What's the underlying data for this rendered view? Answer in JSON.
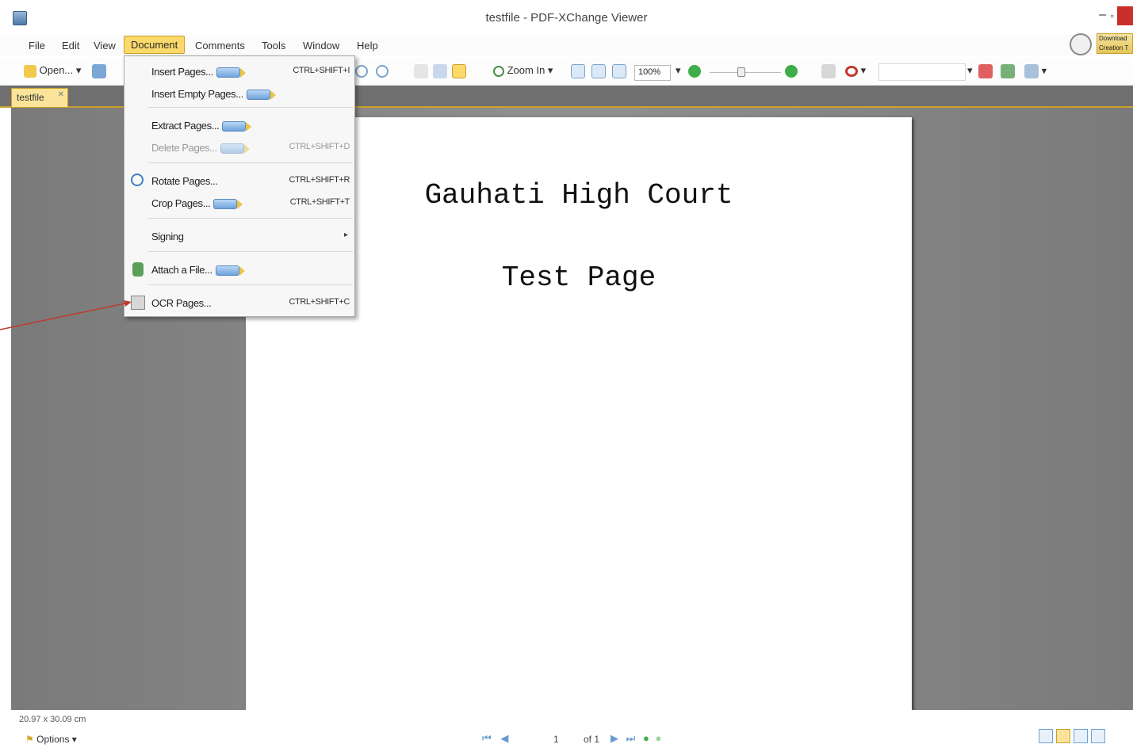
{
  "window": {
    "title": "testfile - PDF-XChange Viewer",
    "minimize_glyph": "–",
    "restore_glyph": "▫"
  },
  "menubar": {
    "items": [
      "File",
      "Edit",
      "View",
      "Document",
      "Comments",
      "Tools",
      "Window",
      "Help"
    ],
    "active": "Document",
    "download_text": "Download Creation T"
  },
  "toolbar": {
    "open_label": "Open...",
    "zoom_in_label": "Zoom In",
    "zoom_value": "100%"
  },
  "tabs": [
    {
      "label": "testfile"
    }
  ],
  "document_menu": {
    "items": [
      {
        "label": "Insert Pages...",
        "shortcut": "CTRL+SHIFT+I",
        "pro": true,
        "disabled": false
      },
      {
        "label": "Insert Empty Pages...",
        "shortcut": "",
        "pro": true,
        "disabled": false
      },
      {
        "label": "Extract Pages...",
        "shortcut": "",
        "pro": true,
        "disabled": false
      },
      {
        "label": "Delete Pages...",
        "shortcut": "CTRL+SHIFT+D",
        "pro": true,
        "disabled": true
      },
      {
        "label": "Rotate Pages...",
        "shortcut": "CTRL+SHIFT+R",
        "pro": false,
        "disabled": false
      },
      {
        "label": "Crop Pages...",
        "shortcut": "CTRL+SHIFT+T",
        "pro": true,
        "disabled": false
      },
      {
        "label": "Signing",
        "shortcut": "",
        "pro": false,
        "disabled": false
      },
      {
        "label": "Attach a File...",
        "shortcut": "",
        "pro": true,
        "disabled": false
      },
      {
        "label": "OCR Pages...",
        "shortcut": "CTRL+SHIFT+C",
        "pro": false,
        "disabled": false
      }
    ]
  },
  "page": {
    "title": "Gauhati High Court",
    "subtitle": "Test Page"
  },
  "statusbar": {
    "dimensions": "20.97 x 30.09 cm",
    "options_label": "Options",
    "page_number": "1",
    "page_total": "of 1"
  },
  "colors": {
    "accent": "#fbd96a",
    "annotation_arrow": "#c0392b",
    "workspace": "#8a8a8a"
  }
}
